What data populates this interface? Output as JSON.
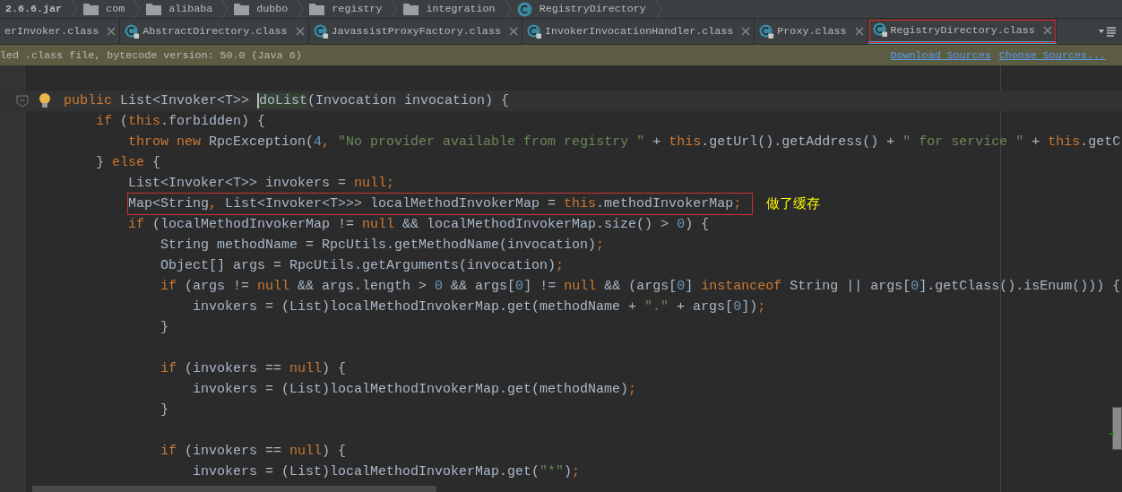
{
  "breadcrumbs": [
    {
      "label": "2.6.6.jar",
      "kind": "jar"
    },
    {
      "label": "com",
      "kind": "folder"
    },
    {
      "label": "alibaba",
      "kind": "folder"
    },
    {
      "label": "dubbo",
      "kind": "folder"
    },
    {
      "label": "registry",
      "kind": "folder"
    },
    {
      "label": "integration",
      "kind": "folder"
    },
    {
      "label": "RegistryDirectory",
      "kind": "class"
    }
  ],
  "tabs": [
    {
      "label": "erInvoker.class",
      "selected": false,
      "icon": false,
      "marked": false
    },
    {
      "label": "AbstractDirectory.class",
      "selected": false,
      "icon": true,
      "marked": false
    },
    {
      "label": "JavassistProxyFactory.class",
      "selected": false,
      "icon": true,
      "marked": false
    },
    {
      "label": "InvokerInvocationHandler.class",
      "selected": false,
      "icon": true,
      "marked": false
    },
    {
      "label": "Proxy.class",
      "selected": false,
      "icon": true,
      "marked": false
    },
    {
      "label": "RegistryDirectory.class",
      "selected": true,
      "icon": true,
      "marked": true
    }
  ],
  "banner": {
    "message": "led .class file, bytecode version: 50.0 (Java 6)",
    "links": [
      "Download Sources",
      "Choose Sources..."
    ]
  },
  "code": [
    {
      "kind": "code",
      "current": true,
      "boxed": false,
      "tokens": [
        {
          "kind": "kw",
          "text": "public "
        },
        {
          "kind": "id",
          "text": "List<Invoker<T>> "
        },
        {
          "kind": "hl",
          "text": "doList"
        },
        {
          "kind": "id",
          "text": "(Invocation invocation) {"
        }
      ],
      "children": [
        {
          "kind": "code",
          "current": false,
          "boxed": false,
          "tokens": [
            {
              "kind": "kw",
              "text": "if "
            },
            {
              "kind": "id",
              "text": "("
            },
            {
              "kind": "kw",
              "text": "this"
            },
            {
              "kind": "id",
              "text": ".forbidden) {"
            }
          ],
          "children": [
            {
              "kind": "code",
              "current": false,
              "boxed": false,
              "tokens": [
                {
                  "kind": "kw",
                  "text": "throw new "
                },
                {
                  "kind": "id",
                  "text": "RpcException("
                },
                {
                  "kind": "num",
                  "text": "4"
                },
                {
                  "kind": "kw",
                  "text": ", "
                },
                {
                  "kind": "str",
                  "text": "\"No provider available from registry \""
                },
                {
                  "kind": "id",
                  "text": " + "
                },
                {
                  "kind": "kw",
                  "text": "this"
                },
                {
                  "kind": "id",
                  "text": ".getUrl().getAddress() + "
                },
                {
                  "kind": "str",
                  "text": "\" for service \""
                },
                {
                  "kind": "id",
                  "text": " + "
                },
                {
                  "kind": "kw",
                  "text": "this"
                },
                {
                  "kind": "id",
                  "text": ".getC"
                }
              ]
            }
          ]
        },
        {
          "kind": "code",
          "current": false,
          "boxed": false,
          "tokens": [
            {
              "kind": "id",
              "text": "} "
            },
            {
              "kind": "kw",
              "text": "else "
            },
            {
              "kind": "id",
              "text": "{"
            }
          ],
          "children": [
            {
              "kind": "code",
              "current": false,
              "boxed": false,
              "tokens": [
                {
                  "kind": "id",
                  "text": "List<Invoker<T>> invokers = "
                },
                {
                  "kind": "kw",
                  "text": "null;"
                }
              ]
            },
            {
              "kind": "code",
              "current": false,
              "boxed": true,
              "note": "做了缓存",
              "tokens": [
                {
                  "kind": "id",
                  "text": "Map<String"
                },
                {
                  "kind": "kw",
                  "text": ", "
                },
                {
                  "kind": "id",
                  "text": "List<Invoker<T>>> localMethodInvokerMap = "
                },
                {
                  "kind": "kw",
                  "text": "this"
                },
                {
                  "kind": "id",
                  "text": ".methodInvokerMap"
                },
                {
                  "kind": "kw",
                  "text": ";"
                }
              ]
            },
            {
              "kind": "code",
              "current": false,
              "boxed": false,
              "tokens": [
                {
                  "kind": "kw",
                  "text": "if "
                },
                {
                  "kind": "id",
                  "text": "(localMethodInvokerMap != "
                },
                {
                  "kind": "kw",
                  "text": "null "
                },
                {
                  "kind": "id",
                  "text": "&& localMethodInvokerMap.size() > "
                },
                {
                  "kind": "num",
                  "text": "0"
                },
                {
                  "kind": "id",
                  "text": ") {"
                }
              ],
              "children": [
                {
                  "kind": "code",
                  "current": false,
                  "boxed": false,
                  "tokens": [
                    {
                      "kind": "id",
                      "text": "String methodName = RpcUtils.getMethodName(invocation)"
                    },
                    {
                      "kind": "kw",
                      "text": ";"
                    }
                  ]
                },
                {
                  "kind": "code",
                  "current": false,
                  "boxed": false,
                  "tokens": [
                    {
                      "kind": "id",
                      "text": "Object[] args = RpcUtils.getArguments(invocation)"
                    },
                    {
                      "kind": "kw",
                      "text": ";"
                    }
                  ]
                },
                {
                  "kind": "code",
                  "current": false,
                  "boxed": false,
                  "tokens": [
                    {
                      "kind": "kw",
                      "text": "if "
                    },
                    {
                      "kind": "id",
                      "text": "(args != "
                    },
                    {
                      "kind": "kw",
                      "text": "null "
                    },
                    {
                      "kind": "id",
                      "text": "&& args.length > "
                    },
                    {
                      "kind": "num",
                      "text": "0"
                    },
                    {
                      "kind": "id",
                      "text": " && args["
                    },
                    {
                      "kind": "num",
                      "text": "0"
                    },
                    {
                      "kind": "id",
                      "text": "] != "
                    },
                    {
                      "kind": "kw",
                      "text": "null "
                    },
                    {
                      "kind": "id",
                      "text": "&& (args["
                    },
                    {
                      "kind": "num",
                      "text": "0"
                    },
                    {
                      "kind": "id",
                      "text": "] "
                    },
                    {
                      "kind": "kw",
                      "text": "instanceof "
                    },
                    {
                      "kind": "id",
                      "text": "String || args["
                    },
                    {
                      "kind": "num",
                      "text": "0"
                    },
                    {
                      "kind": "id",
                      "text": "].getClass().isEnum())) {"
                    }
                  ],
                  "children": [
                    {
                      "kind": "code",
                      "current": false,
                      "boxed": false,
                      "tokens": [
                        {
                          "kind": "id",
                          "text": "invokers = (List)localMethodInvokerMap.get(methodName + "
                        },
                        {
                          "kind": "str",
                          "text": "\".\""
                        },
                        {
                          "kind": "id",
                          "text": " + args["
                        },
                        {
                          "kind": "num",
                          "text": "0"
                        },
                        {
                          "kind": "id",
                          "text": "])"
                        },
                        {
                          "kind": "kw",
                          "text": ";"
                        }
                      ]
                    }
                  ]
                },
                {
                  "kind": "code",
                  "current": false,
                  "boxed": false,
                  "tokens": [
                    {
                      "kind": "id",
                      "text": "}"
                    }
                  ]
                },
                {
                  "kind": "blank"
                },
                {
                  "kind": "code",
                  "current": false,
                  "boxed": false,
                  "tokens": [
                    {
                      "kind": "kw",
                      "text": "if "
                    },
                    {
                      "kind": "id",
                      "text": "(invokers == "
                    },
                    {
                      "kind": "kw",
                      "text": "null"
                    },
                    {
                      "kind": "id",
                      "text": ") {"
                    }
                  ],
                  "children": [
                    {
                      "kind": "code",
                      "current": false,
                      "boxed": false,
                      "tokens": [
                        {
                          "kind": "id",
                          "text": "invokers = (List)localMethodInvokerMap.get(methodName)"
                        },
                        {
                          "kind": "kw",
                          "text": ";"
                        }
                      ]
                    }
                  ]
                },
                {
                  "kind": "code",
                  "current": false,
                  "boxed": false,
                  "tokens": [
                    {
                      "kind": "id",
                      "text": "}"
                    }
                  ]
                },
                {
                  "kind": "blank"
                },
                {
                  "kind": "code",
                  "current": false,
                  "boxed": false,
                  "tokens": [
                    {
                      "kind": "kw",
                      "text": "if "
                    },
                    {
                      "kind": "id",
                      "text": "(invokers == "
                    },
                    {
                      "kind": "kw",
                      "text": "null"
                    },
                    {
                      "kind": "id",
                      "text": ") {"
                    }
                  ],
                  "children": [
                    {
                      "kind": "code",
                      "current": false,
                      "boxed": false,
                      "tokens": [
                        {
                          "kind": "id",
                          "text": "invokers = (List)localMethodInvokerMap.get("
                        },
                        {
                          "kind": "str",
                          "text": "\"*\""
                        },
                        {
                          "kind": "id",
                          "text": ")"
                        },
                        {
                          "kind": "kw",
                          "text": ";"
                        }
                      ]
                    }
                  ]
                }
              ]
            }
          ]
        }
      ]
    }
  ]
}
